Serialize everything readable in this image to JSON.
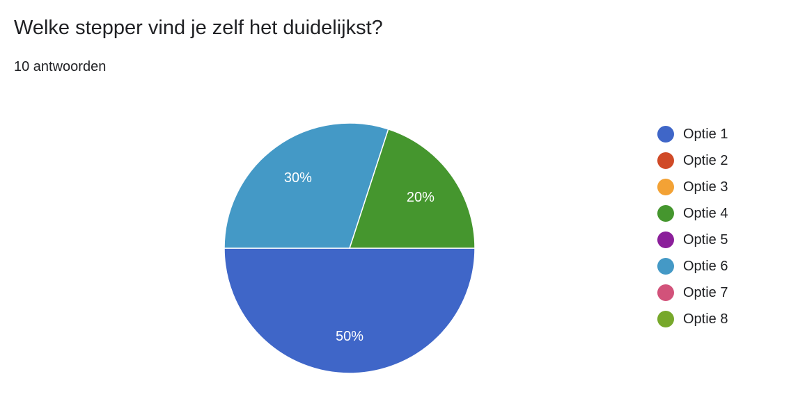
{
  "header": {
    "title": "Welke stepper vind je zelf het duidelijkst?",
    "response_count": "10 antwoorden"
  },
  "chart_data": {
    "type": "pie",
    "title": "Welke stepper vind je zelf het duidelijkst?",
    "categories": [
      "Optie 1",
      "Optie 2",
      "Optie 3",
      "Optie 4",
      "Optie 5",
      "Optie 6",
      "Optie 7",
      "Optie 8"
    ],
    "values": [
      50,
      0,
      0,
      20,
      0,
      30,
      0,
      0
    ],
    "value_labels": [
      "50%",
      "",
      "",
      "20%",
      "",
      "30%",
      "",
      ""
    ],
    "colors": [
      "#3f66c8",
      "#d04a27",
      "#f3a235",
      "#45962e",
      "#8b1f9a",
      "#4499c6",
      "#d2527a",
      "#77a82b"
    ],
    "legend_position": "right"
  }
}
